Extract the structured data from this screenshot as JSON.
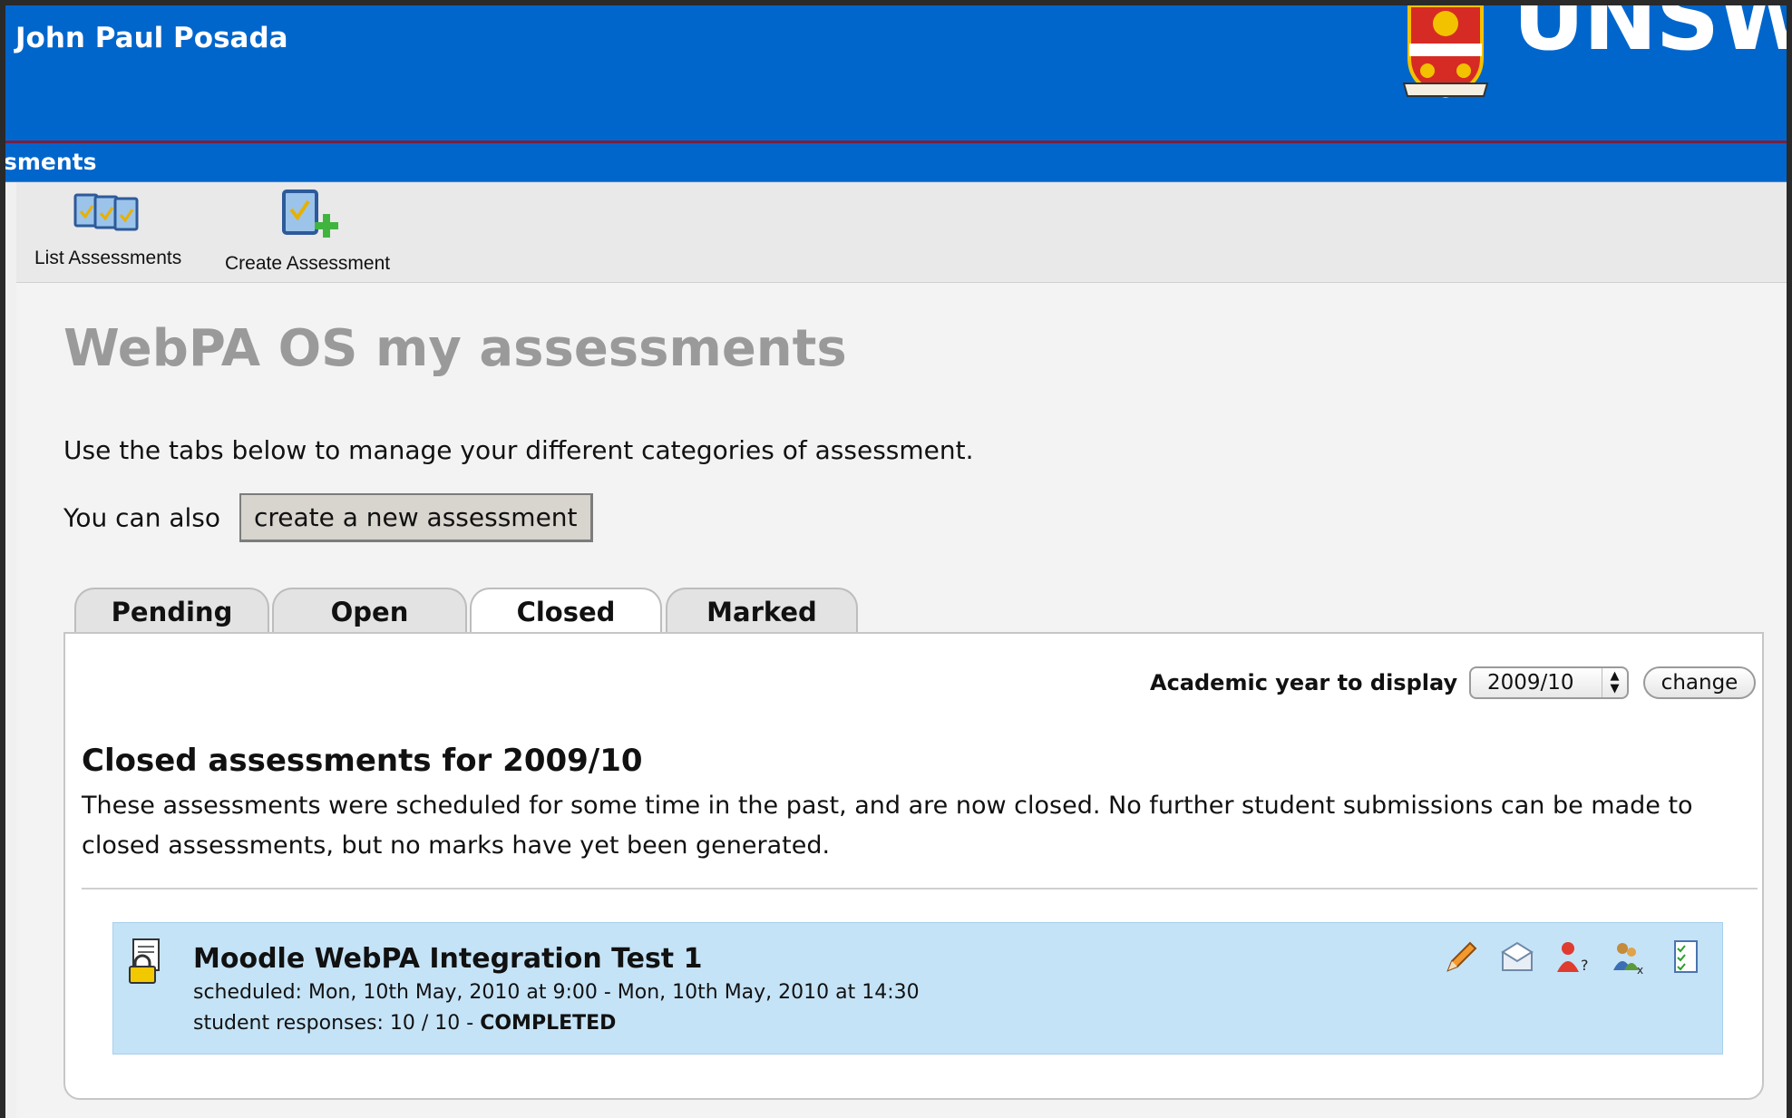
{
  "header": {
    "user_name": "John Paul Posada",
    "brand": "UNSW",
    "nav_text": "sments"
  },
  "toolbar": {
    "list_label": "List Assessments",
    "create_label": "Create Assessment"
  },
  "page": {
    "title": "WebPA OS my assessments",
    "intro": "Use the tabs below to manage your different categories of assessment.",
    "also_text": "You can also",
    "create_button": "create a new assessment"
  },
  "tabs": [
    {
      "label": "Pending",
      "active": false
    },
    {
      "label": "Open",
      "active": false
    },
    {
      "label": "Closed",
      "active": true
    },
    {
      "label": "Marked",
      "active": false
    }
  ],
  "filter": {
    "label": "Academic year to display",
    "selected_year": "2009/10",
    "change_button": "change"
  },
  "section": {
    "heading": "Closed assessments for 2009/10",
    "description": "These assessments were scheduled for some time in the past, and are now closed. No further student submissions can be made to closed assessments, but no marks have yet been generated."
  },
  "assessment": {
    "title": "Moodle WebPA Integration Test 1",
    "scheduled": "scheduled: Mon, 10th May, 2010 at 9:00  -  Mon, 10th May, 2010 at 14:30",
    "responses_prefix": "student responses: 10 / 10 - ",
    "status": "COMPLETED",
    "icons": [
      "edit-icon",
      "email-icon",
      "student-help-icon",
      "mark-sheet-icon",
      "checklist-icon"
    ]
  },
  "colors": {
    "header_blue": "#0066cc",
    "row_highlight": "#c5e3f7",
    "title_gray": "#9a9a9a"
  }
}
